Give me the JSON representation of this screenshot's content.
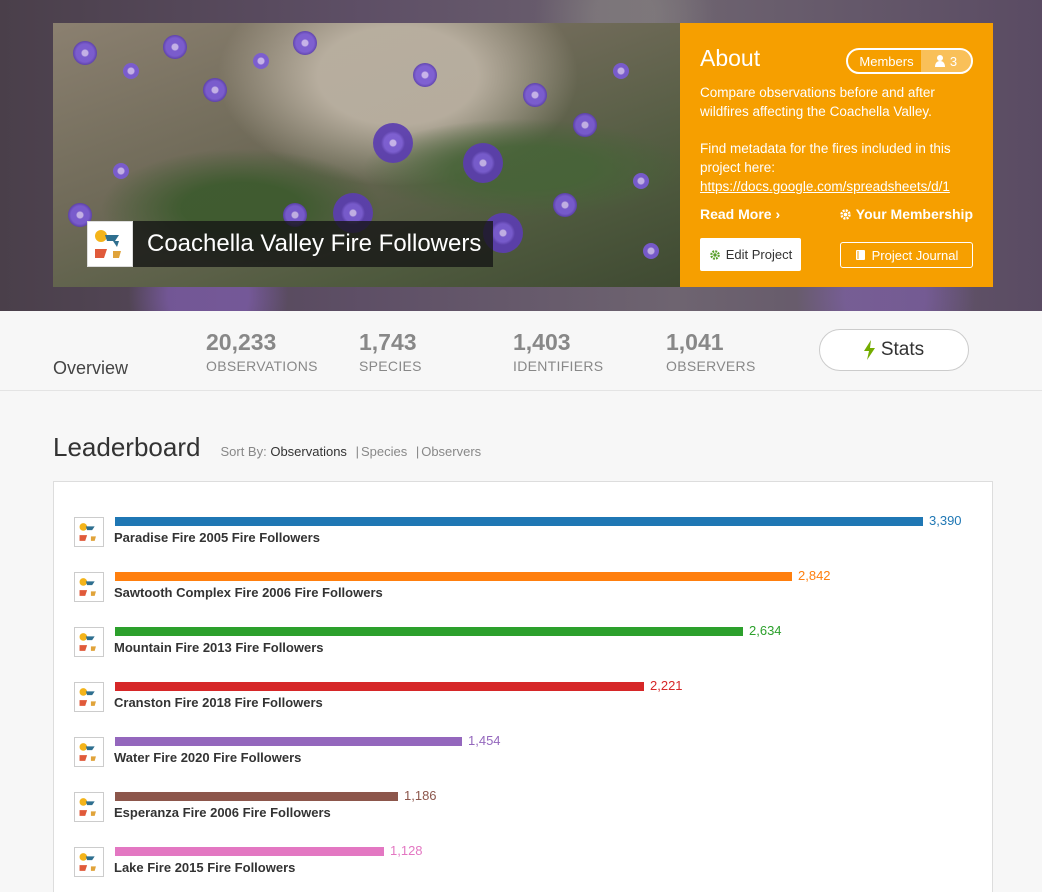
{
  "project": {
    "title": "Coachella Valley Fire Followers"
  },
  "about": {
    "title": "About",
    "members_label": "Members",
    "members_count": "3",
    "description_1": "Compare observations before and after wildfires affecting the Coachella Valley.",
    "description_2": "Find metadata for the fires included in this project here:",
    "link_text": "https://docs.google.com/spreadsheets/d/1",
    "read_more": "Read More",
    "your_membership": "Your Membership",
    "edit_project": "Edit Project",
    "project_journal": "Project Journal",
    "bg_color": "#f69f00"
  },
  "stats": {
    "overview": "Overview",
    "observations_value": "20,233",
    "observations_label": "OBSERVATIONS",
    "species_value": "1,743",
    "species_label": "SPECIES",
    "identifiers_value": "1,403",
    "identifiers_label": "IDENTIFIERS",
    "observers_value": "1,041",
    "observers_label": "OBSERVERS",
    "stats_button": "Stats"
  },
  "leaderboard": {
    "title": "Leaderboard",
    "sort_by": "Sort By:",
    "sort_observations": "Observations",
    "sort_species": "Species",
    "sort_observers": "Observers",
    "sort_sep": "|"
  },
  "chart_data": {
    "type": "bar",
    "orientation": "horizontal",
    "categories": [
      "Paradise Fire 2005 Fire Followers",
      "Sawtooth Complex Fire 2006 Fire Followers",
      "Mountain Fire 2013 Fire Followers",
      "Cranston Fire 2018 Fire Followers",
      "Water Fire 2020 Fire Followers",
      "Esperanza Fire 2006 Fire Followers",
      "Lake Fire 2015 Fire Followers"
    ],
    "values": [
      3390,
      2842,
      2634,
      2221,
      1454,
      1186,
      1128
    ],
    "value_labels": [
      "3,390",
      "2,842",
      "2,634",
      "2,221",
      "1,454",
      "1,186",
      "1,128"
    ],
    "colors": [
      "#1f77b4",
      "#ff7f0e",
      "#2ca02c",
      "#d62728",
      "#9467bd",
      "#8c564b",
      "#e377c2"
    ],
    "max": 3390
  }
}
